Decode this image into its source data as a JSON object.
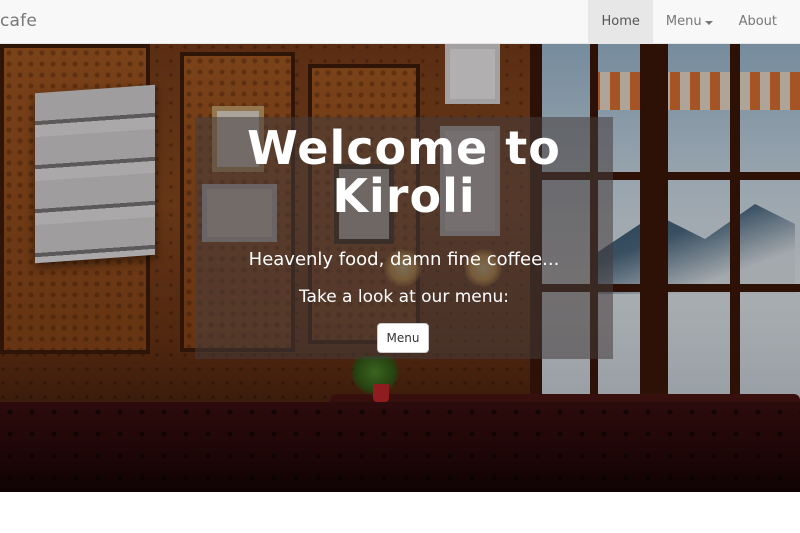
{
  "navbar": {
    "brand": "cafe",
    "items": [
      {
        "label": "Home",
        "active": true
      },
      {
        "label": "Menu",
        "has_dropdown": true
      },
      {
        "label": "About"
      }
    ]
  },
  "hero": {
    "title": "Welcome to Kiroli",
    "tagline": "Heavenly food, damn fine coffee...",
    "cta_text": "Take a look at our menu:",
    "button_label": "Menu"
  },
  "colors": {
    "navbar_bg": "#f8f8f8",
    "active_nav_bg": "#e7e7e7",
    "nav_text": "#777777",
    "hero_text": "#ffffff",
    "hero_overlay": "rgba(70,60,60,0.55)"
  }
}
